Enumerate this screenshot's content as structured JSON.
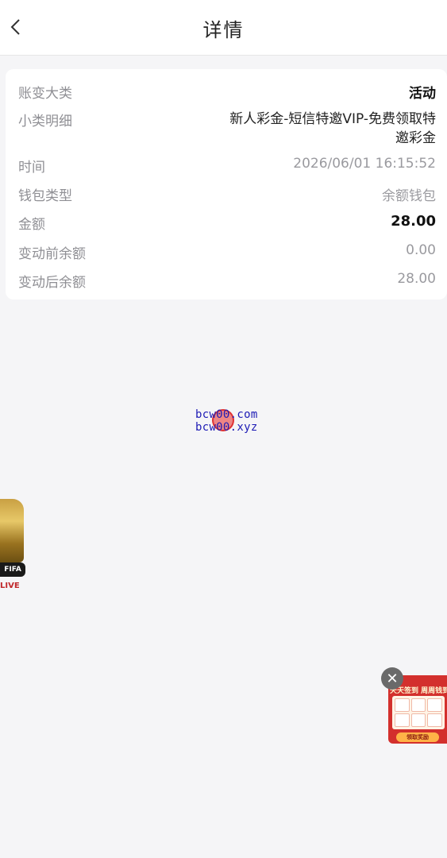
{
  "header": {
    "title": "详情"
  },
  "detail": {
    "rows": [
      {
        "label": "账变大类",
        "value": "活动"
      },
      {
        "label": "小类明细",
        "value": "新人彩金-短信特邀VIP-免费领取特邀彩金"
      },
      {
        "label": "时间",
        "value": "2026/06/01 16:15:52"
      },
      {
        "label": "钱包类型",
        "value": "余额钱包"
      },
      {
        "label": "金额",
        "value": "28.00"
      },
      {
        "label": "变动前余额",
        "value": "0.00"
      },
      {
        "label": "变动后余额",
        "value": "28.00"
      }
    ]
  },
  "watermark": {
    "line1": "bcw00.com",
    "line2": "bcw00.xyz"
  },
  "trophy_float": {
    "badge": "FIFA",
    "live_text": "LIVE"
  },
  "promo_float": {
    "close_symbol": "✕",
    "title": "天天签到 周周钱到",
    "button": "领取奖励"
  },
  "colors": {
    "background": "#f5f5f7",
    "card": "#ffffff",
    "label": "#8f8f94",
    "value_muted": "#9a9a9f",
    "value_strong": "#111111",
    "watermark": "#1d1bb5",
    "promo_red": "#d3302d"
  },
  "icons": {
    "back": "chevron-left-icon",
    "close": "close-icon"
  }
}
